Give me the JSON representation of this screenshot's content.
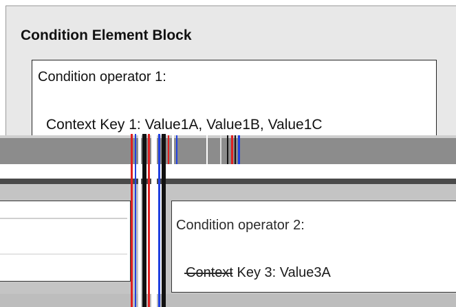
{
  "diagram": {
    "block_title": "Condition Element Block",
    "operator_1": "Condition operator 1:",
    "context_line_1": "Context Key 1: Value1A,  Value1B,  Value1C",
    "operator_2": "Condition operator 2:",
    "context_line_2": "Context Key 3:  Value3A"
  },
  "colors": {
    "block_background": "#e8e8e8",
    "glitch_band": "#8c8c8c",
    "lower_background": "#c4c4c4",
    "stripe_red": "#e02020",
    "stripe_blue": "#2040e0"
  }
}
